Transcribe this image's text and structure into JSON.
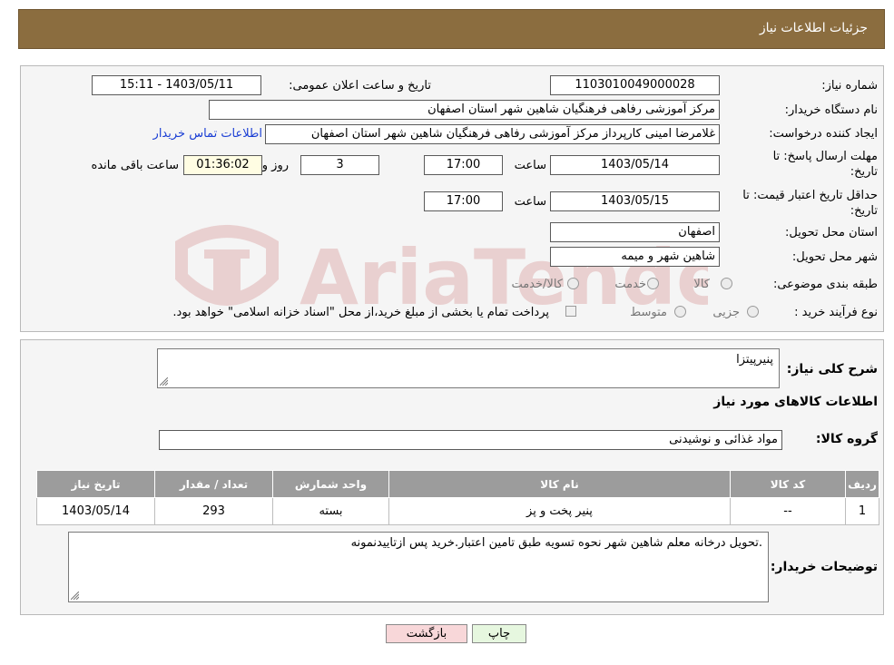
{
  "header": {
    "title": "جزئیات اطلاعات نیاز"
  },
  "fields": {
    "need_number_label": "شماره نیاز:",
    "need_number": "1103010049000028",
    "announce_label": "تاریخ و ساعت اعلان عمومی:",
    "announce_value": "1403/05/11 - 15:11",
    "buyer_org_label": "نام دستگاه خریدار:",
    "buyer_org": "مرکز آموزشی رفاهی فرهنگیان شاهین شهر استان اصفهان",
    "creator_label": "ایجاد کننده درخواست:",
    "creator": "غلامرضا امینی کارپرداز مرکز آموزشی رفاهی فرهنگیان شاهین شهر استان اصفهان",
    "contact_link": "اطلاعات تماس خریدار",
    "deadline_label_1": "مهلت ارسال پاسخ: تا",
    "deadline_label_2": "تاریخ:",
    "deadline_date": "1403/05/14",
    "time_label": "ساعت",
    "deadline_time": "17:00",
    "days": "3",
    "days_label": "روز و",
    "remaining_time": "01:36:02",
    "remaining_label": "ساعت باقی مانده",
    "validity_label_1": "حداقل تاریخ اعتبار قیمت: تا",
    "validity_label_2": "تاریخ:",
    "validity_date": "1403/05/15",
    "validity_time": "17:00",
    "province_label": "استان محل تحویل:",
    "province": "اصفهان",
    "city_label": "شهر محل تحویل:",
    "city": "شاهین شهر و میمه",
    "category_label": "طبقه بندی موضوعی:",
    "category_options": [
      "کالا",
      "خدمت",
      "کالا/خدمت"
    ],
    "process_label": "نوع فرآیند خرید :",
    "process_options": [
      "جزیی",
      "متوسط"
    ],
    "payment_note": "پرداخت تمام یا بخشی از مبلغ خرید،از محل \"اسناد خزانه اسلامی\" خواهد بود."
  },
  "details": {
    "summary_label": "شرح کلی نیاز:",
    "summary": "پنیرپیتزا",
    "goods_info_title": "اطلاعات کالاهای مورد نیاز",
    "goods_group_label": "گروه کالا:",
    "goods_group": "مواد غذائی و نوشیدنی",
    "columns": [
      "ردیف",
      "کد کالا",
      "نام کالا",
      "واحد شمارش",
      "تعداد / مقدار",
      "تاریخ نیاز"
    ],
    "rows": [
      [
        "1",
        "--",
        "پنیر پخت و پز",
        "بسته",
        "293",
        "1403/05/14"
      ]
    ],
    "buyer_notes_label": "توضیحات خریدار:",
    "buyer_notes": ".تحویل درخانه معلم شاهین شهر نحوه تسویه طبق تامین اعتبار.خرید پس ازتاییدنمونه"
  },
  "buttons": {
    "back": "بازگشت",
    "print": "چاپ"
  },
  "watermark_text": "AriaTender.neT",
  "colors": {
    "header_bg": "#8b6d3f",
    "back_btn_bg": "#f8d7d9",
    "print_btn_bg": "#e6f7df",
    "link": "#1a3ed4"
  }
}
